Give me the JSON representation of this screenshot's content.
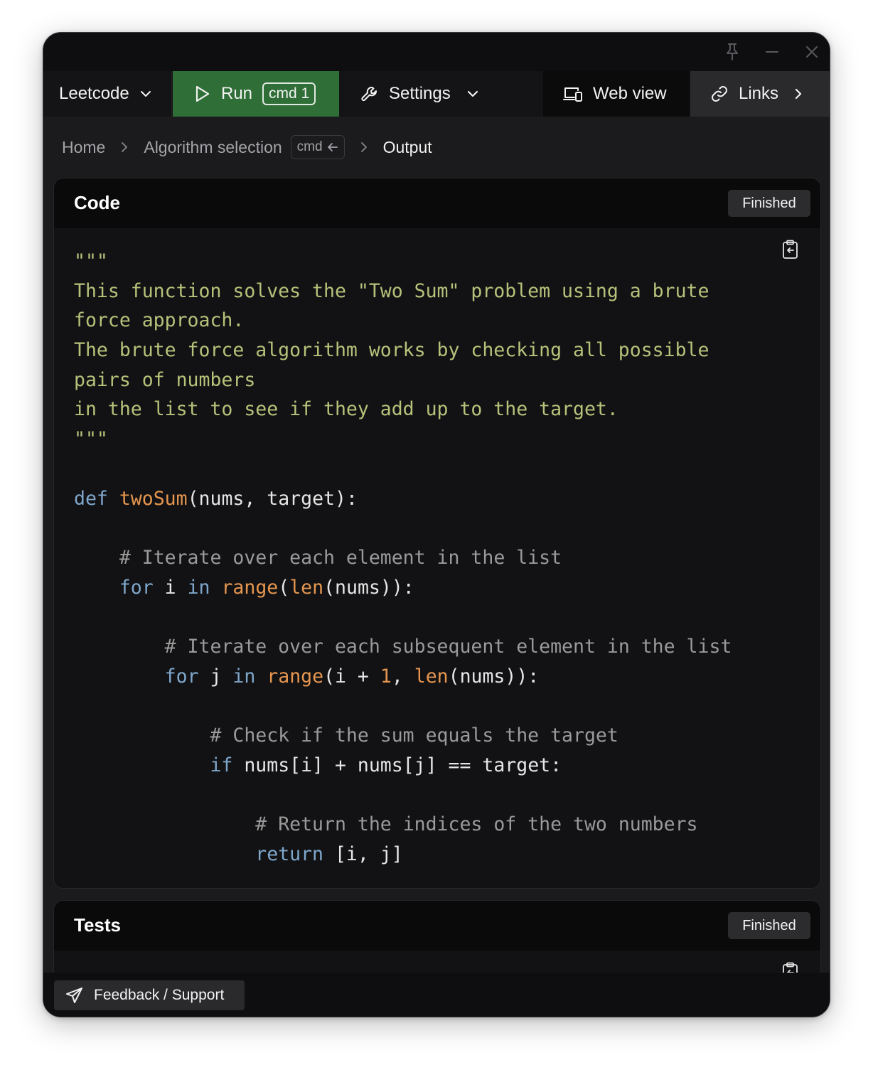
{
  "toolbar": {
    "project_label": "Leetcode",
    "run_label": "Run",
    "run_shortcut": "cmd 1",
    "settings_label": "Settings",
    "webview_label": "Web view",
    "links_label": "Links"
  },
  "breadcrumb": {
    "home": "Home",
    "algorithm": "Algorithm selection",
    "algorithm_shortcut": "cmd",
    "current": "Output"
  },
  "code_panel": {
    "title": "Code",
    "status": "Finished",
    "lines": [
      [
        {
          "t": "\"\"\"",
          "c": "doc"
        }
      ],
      [
        {
          "t": "This function solves the \"Two Sum\" problem using a brute",
          "c": "doc"
        }
      ],
      [
        {
          "t": "force approach.",
          "c": "doc"
        }
      ],
      [
        {
          "t": "The brute force algorithm works by checking all possible",
          "c": "doc"
        }
      ],
      [
        {
          "t": "pairs of numbers",
          "c": "doc"
        }
      ],
      [
        {
          "t": "in the list to see if they add up to the target.",
          "c": "doc"
        }
      ],
      [
        {
          "t": "\"\"\"",
          "c": "doc"
        }
      ],
      [],
      [
        {
          "t": "def",
          "c": "kw"
        },
        {
          "t": " "
        },
        {
          "t": "twoSum",
          "c": "fn"
        },
        {
          "t": "(nums, target):"
        }
      ],
      [],
      [
        {
          "t": "    "
        },
        {
          "t": "# Iterate over each element in the list",
          "c": "cm"
        }
      ],
      [
        {
          "t": "    "
        },
        {
          "t": "for",
          "c": "kw"
        },
        {
          "t": " i "
        },
        {
          "t": "in",
          "c": "kw"
        },
        {
          "t": " "
        },
        {
          "t": "range",
          "c": "fn"
        },
        {
          "t": "("
        },
        {
          "t": "len",
          "c": "fn"
        },
        {
          "t": "(nums)):"
        }
      ],
      [],
      [
        {
          "t": "        "
        },
        {
          "t": "# Iterate over each subsequent element in the list",
          "c": "cm"
        }
      ],
      [
        {
          "t": "        "
        },
        {
          "t": "for",
          "c": "kw"
        },
        {
          "t": " j "
        },
        {
          "t": "in",
          "c": "kw"
        },
        {
          "t": " "
        },
        {
          "t": "range",
          "c": "fn"
        },
        {
          "t": "(i + "
        },
        {
          "t": "1",
          "c": "num"
        },
        {
          "t": ", "
        },
        {
          "t": "len",
          "c": "fn"
        },
        {
          "t": "(nums)):"
        }
      ],
      [],
      [
        {
          "t": "            "
        },
        {
          "t": "# Check if the sum equals the target",
          "c": "cm"
        }
      ],
      [
        {
          "t": "            "
        },
        {
          "t": "if",
          "c": "kw"
        },
        {
          "t": " nums[i] + nums[j] == target:"
        }
      ],
      [],
      [
        {
          "t": "                "
        },
        {
          "t": "# Return the indices of the two numbers",
          "c": "cm"
        }
      ],
      [
        {
          "t": "                "
        },
        {
          "t": "return",
          "c": "kw"
        },
        {
          "t": " [i, j]"
        }
      ]
    ]
  },
  "tests_panel": {
    "title": "Tests",
    "status": "Finished"
  },
  "footer": {
    "feedback_label": "Feedback / Support"
  }
}
